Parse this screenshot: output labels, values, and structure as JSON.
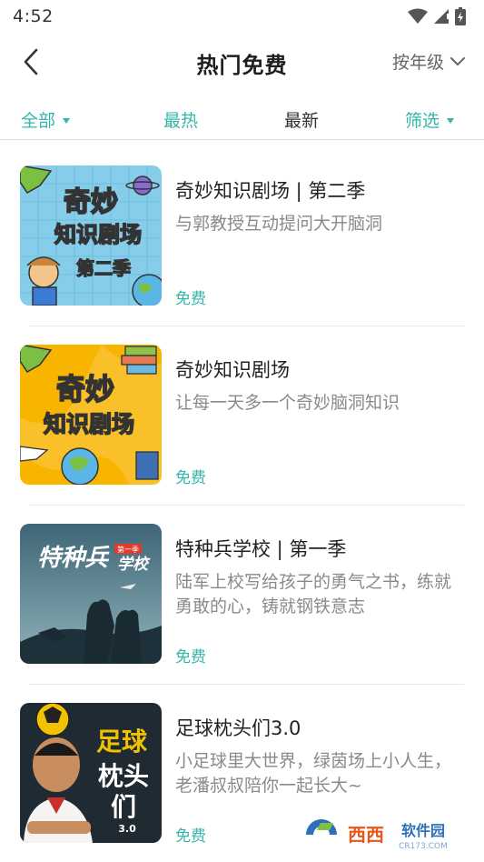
{
  "status_bar": {
    "time": "4:52"
  },
  "header": {
    "title": "热门免费",
    "grade_label": "按年级"
  },
  "filters": {
    "all_label": "全部",
    "hot_label": "最热",
    "new_label": "最新",
    "filter_label": "筛选"
  },
  "items": [
    {
      "title": "奇妙知识剧场 | 第二季",
      "description": "与郭教授互动提问大开脑洞",
      "price": "免费",
      "cover_text_1": "奇妙",
      "cover_text_2": "知识剧场",
      "cover_text_3": "第二季"
    },
    {
      "title": "奇妙知识剧场",
      "description": "让每一天多一个奇妙脑洞知识",
      "price": "免费",
      "cover_text_1": "奇妙",
      "cover_text_2": "知识剧场"
    },
    {
      "title": "特种兵学校 | 第一季",
      "description": "陆军上校写给孩子的勇气之书，练就勇敢的心，铸就钢铁意志",
      "price": "免费",
      "cover_text_1": "特种兵",
      "cover_text_2": "学校",
      "cover_badge": "第一季"
    },
    {
      "title": "足球枕头们3.0",
      "description": "小足球里大世界，绿茵场上小人生，老潘叔叔陪你一起长大~",
      "price": "免费",
      "cover_text_1": "足球",
      "cover_text_2": "枕头",
      "cover_text_3": "们",
      "cover_text_4": "3.0"
    }
  ],
  "watermark": {
    "brand": "西西",
    "label": "软件园",
    "url": "CR173.COM"
  },
  "colors": {
    "accent": "#34b7ab",
    "cover_blue": "#7ec8e8",
    "cover_yellow": "#f5b400",
    "cover_dark": "#2f4c5a"
  }
}
